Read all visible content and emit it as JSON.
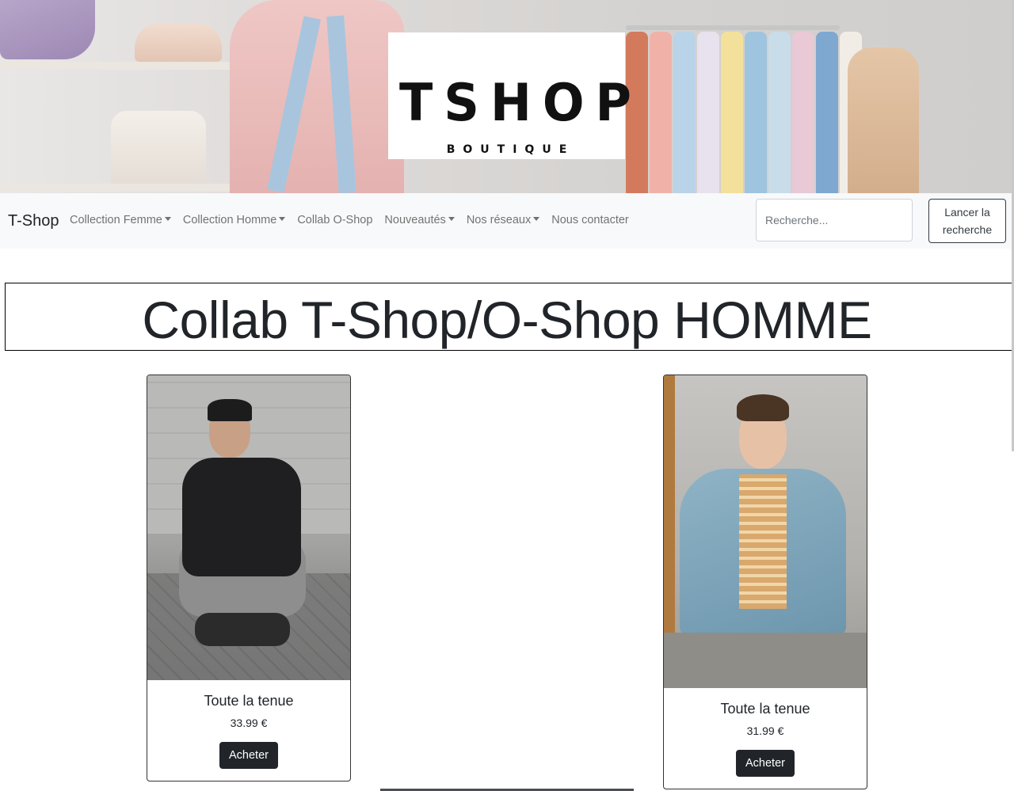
{
  "hero": {
    "logo_main": "TSHOP",
    "logo_sub": "BOUTIQUE",
    "image_name": "boutique-banner-photo"
  },
  "navbar": {
    "brand": "T-Shop",
    "items": [
      {
        "label": "Collection Femme",
        "dropdown": true
      },
      {
        "label": "Collection Homme",
        "dropdown": true
      },
      {
        "label": "Collab O-Shop",
        "dropdown": false
      },
      {
        "label": "Nouveautés",
        "dropdown": true
      },
      {
        "label": "Nos réseaux",
        "dropdown": true
      },
      {
        "label": "Nous contacter",
        "dropdown": false
      }
    ],
    "search": {
      "placeholder": "Recherche...",
      "button_label": "Lancer la recherche"
    }
  },
  "main": {
    "title": "Collab T-Shop/O-Shop HOMME",
    "products": [
      {
        "title": "Toute la tenue",
        "price": "33.99 €",
        "button": "Acheter"
      },
      {
        "title": "Toute la tenue",
        "price": "31.99 €",
        "button": "Acheter"
      }
    ]
  },
  "colors": {
    "navbar_bg": "#f8f9fa",
    "button_dark": "#212529",
    "text": "#212529"
  }
}
